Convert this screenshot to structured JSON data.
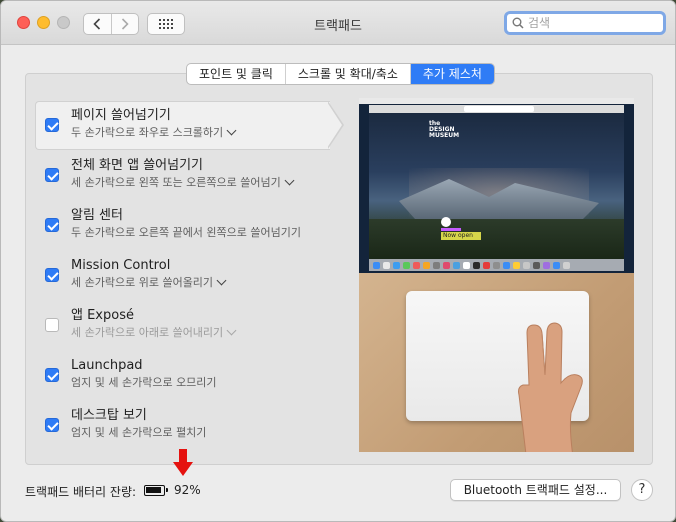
{
  "window": {
    "title": "트랙패드",
    "search_placeholder": "검색"
  },
  "tabs": [
    {
      "label": "포인트 및 클릭",
      "active": false
    },
    {
      "label": "스크롤 및 확대/축소",
      "active": false
    },
    {
      "label": "추가 제스처",
      "active": true
    }
  ],
  "gestures": [
    {
      "title": "페이지 쓸어넘기기",
      "subtitle": "두 손가락으로 좌우로 스크롤하기",
      "checked": true,
      "dropdown": true,
      "selected": true
    },
    {
      "title": "전체 화면 앱 쓸어넘기기",
      "subtitle": "세 손가락으로 왼쪽 또는 오른쪽으로 쓸어넘기",
      "checked": true,
      "dropdown": true
    },
    {
      "title": "알림 센터",
      "subtitle": "두 손가락으로 오른쪽 끝에서 왼쪽으로 쓸어넘기기",
      "checked": true,
      "dropdown": false
    },
    {
      "title": "Mission Control",
      "subtitle": "세 손가락으로 위로 쓸어올리기",
      "checked": true,
      "dropdown": true
    },
    {
      "title": "앱 Exposé",
      "subtitle": "세 손가락으로 아래로 쓸어내리기",
      "checked": false,
      "dropdown": true
    },
    {
      "title": "Launchpad",
      "subtitle": "엄지 및 세 손가락으로 오므리기",
      "checked": true,
      "dropdown": false
    },
    {
      "title": "데스크탑 보기",
      "subtitle": "엄지 및 세 손가락으로 펼치기",
      "checked": true,
      "dropdown": false
    }
  ],
  "preview": {
    "site_logo": "the DESIGN MUSEUM",
    "banner_text": "Now open"
  },
  "footer": {
    "battery_label": "트랙패드 배터리 잔량:",
    "battery_percent": "92%",
    "bluetooth_button": "Bluetooth 트랙패드 설정...",
    "help_label": "?"
  },
  "colors": {
    "accent": "#2f7cf6",
    "annotation_arrow": "#e5120f"
  }
}
